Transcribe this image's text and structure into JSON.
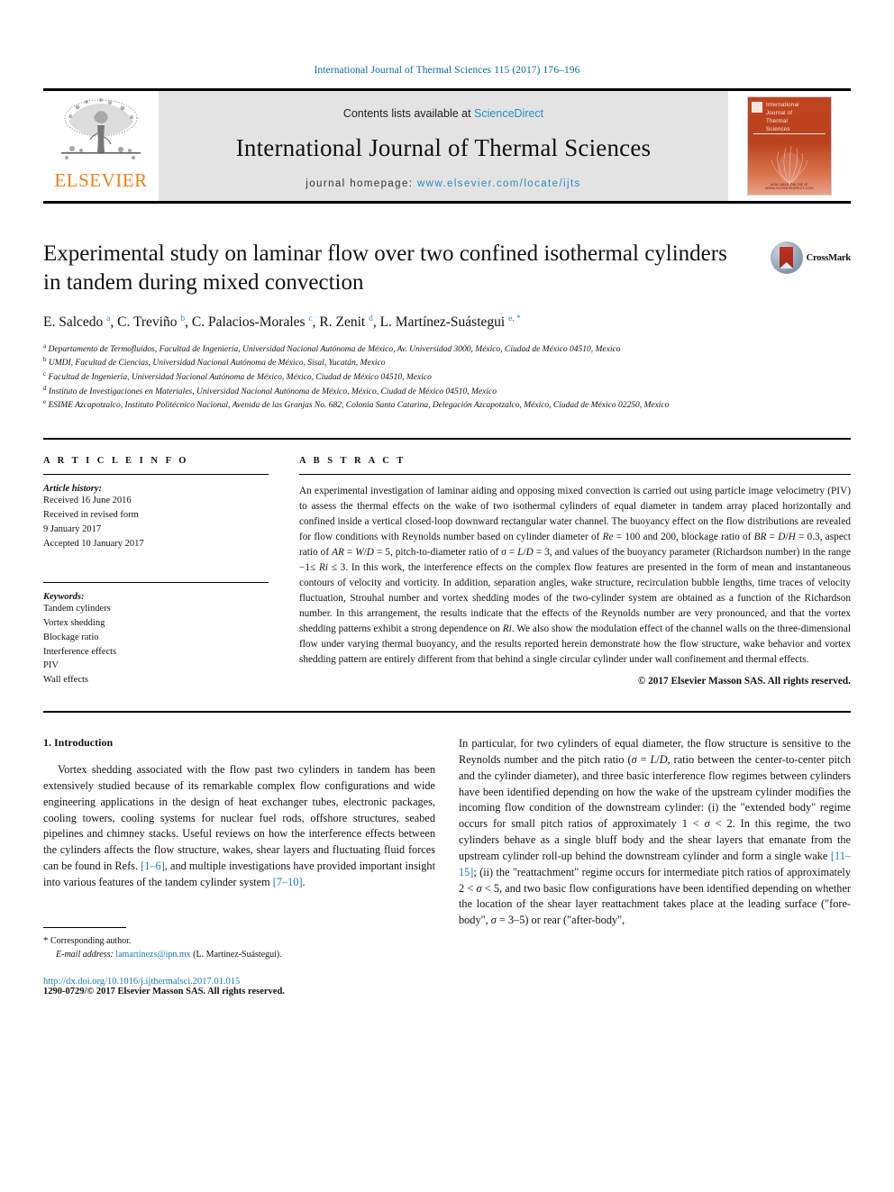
{
  "running_head": "International Journal of Thermal Sciences 115 (2017) 176–196",
  "masthead": {
    "contents_prefix": "Contents lists available at ",
    "sciencedirect": "ScienceDirect",
    "journal_title": "International Journal of Thermal Sciences",
    "homepage_prefix": "journal homepage: ",
    "homepage_url": "www.elsevier.com/locate/ijts",
    "publisher_logo_text": "ELSEVIER",
    "cover_title_lines": "International\nJournal of\nThermal\nSciences",
    "cover_footer": "AVAILABLE ONLINE AT WWW.SCIENCEDIRECT.COM",
    "accent_blue": "#2b8cc4",
    "elsevier_orange": "#f07f13",
    "cover_red": "#bb431e"
  },
  "article": {
    "title": "Experimental study on laminar flow over two confined isothermal cylinders in tandem during mixed convection",
    "authors_html": "E. Salcedo <sup>a</sup>, C. Treviño <sup>b</sup>, C. Palacios-Morales <sup>c</sup>, R. Zenit <sup>d</sup>, L. Martínez-Suástegui <sup>e, <span class=\"star\">*</span></sup>",
    "crossmark_label": "CrossMark",
    "affiliations": [
      "Departamento de Termofluidos, Facultad de Ingeniería, Universidad Nacional Autónoma de México, Av. Universidad 3000, México, Ciudad de México 04510, Mexico",
      "UMDI, Facultad de Ciencias, Universidad Nacional Autónoma de México, Sisal, Yucatán, Mexico",
      "Facultad de Ingeniería, Universidad Nacional Autónoma de México, México, Ciudad de México 04510, Mexico",
      "Instituto de Investigaciones en Materiales, Universidad Nacional Autónoma de México, México, Ciudad de México 04510, Mexico",
      "ESIME Azcapotzalco, Instituto Politécnico Nacional, Avenida de las Granjas No. 682, Colonia Santa Catarina, Delegación Azcapotzalco, México, Ciudad de México 02250, Mexico"
    ],
    "affiliation_markers": [
      "a",
      "b",
      "c",
      "d",
      "e"
    ]
  },
  "article_info": {
    "heading": "A R T I C L E   I N F O",
    "history_label": "Article history:",
    "history_lines": [
      "Received 16 June 2016",
      "Received in revised form",
      "9 January 2017",
      "Accepted 10 January 2017"
    ],
    "keywords_label": "Keywords:",
    "keywords": [
      "Tandem cylinders",
      "Vortex shedding",
      "Blockage ratio",
      "Interference effects",
      "PIV",
      "Wall effects"
    ]
  },
  "abstract": {
    "heading": "A B S T R A C T",
    "text_html": "An experimental investigation of laminar aiding and opposing mixed convection is carried out using particle image velocimetry (PIV) to assess the thermal effects on the wake of two isothermal cylinders of equal diameter in tandem array placed horizontally and confined inside a vertical closed-loop downward rectangular water channel. The buoyancy effect on the flow distributions are revealed for flow conditions with Reynolds number based on cylinder diameter of <i>Re</i> = 100 and 200, blockage ratio of <i>BR</i> = <i>D</i>/<i>H</i> = 0.3, aspect ratio of <i>AR</i> = <i>W</i>/<i>D</i> = 5, pitch-to-diameter ratio of <i>&sigma;</i> = <i>L</i>/<i>D</i> = 3, and values of the buoyancy parameter (Richardson number) in the range &minus;1&le; <i>Ri</i> &le; 3. In this work, the interference effects on the complex flow features are presented in the form of mean and instantaneous contours of velocity and vorticity. In addition, separation angles, wake structure, recirculation bubble lengths, time traces of velocity fluctuation, Strouhal number and vortex shedding modes of the two-cylinder system are obtained as a function of the Richardson number. In this arrangement, the results indicate that the effects of the Reynolds number are very pronounced, and that the vortex shedding patterns exhibit a strong dependence on <i>Ri</i>. We also show the modulation effect of the channel walls on the three-dimensional flow under varying thermal buoyancy, and the results reported herein demonstrate how the flow structure, wake behavior and vortex shedding pattern are entirely different from that behind a single circular cylinder under wall confinement and thermal effects.",
    "copyright": "© 2017 Elsevier Masson SAS. All rights reserved."
  },
  "body": {
    "section_heading": "1. Introduction",
    "left_paragraph_html": "Vortex shedding associated with the flow past two cylinders in tandem has been extensively studied because of its remarkable complex flow configurations and wide engineering applications in the design of heat exchanger tubes, electronic packages, cooling towers, cooling systems for nuclear fuel rods, offshore structures, seabed pipelines and chimney stacks. Useful reviews on how the interference effects between the cylinders affects the flow structure, wakes, shear layers and fluctuating fluid forces can be found in Refs. <span class=\"ref\">[1&ndash;6]</span>, and multiple investigations have provided important insight into various features of the tandem cylinder system <span class=\"ref\">[7&ndash;10]</span>.",
    "right_paragraph_html": "In particular, for two cylinders of equal diameter, the flow structure is sensitive to the Reynolds number and the pitch ratio (<i>&sigma;</i> = <i>L</i>/<i>D</i>, ratio between the center-to-center pitch and the cylinder diameter), and three basic interference flow regimes between cylinders have been identified depending on how the wake of the upstream cylinder modifies the incoming flow condition of the downstream cylinder: (i) the &quot;extended body&quot; regime occurs for small pitch ratios of approximately 1 &lt; <i>&sigma;</i> &lt; 2. In this regime, the two cylinders behave as a single bluff body and the shear layers that emanate from the upstream cylinder roll-up behind the downstream cylinder and form a single wake <span class=\"ref\">[11&ndash;15]</span>; (ii) the &quot;reattachment&quot; regime occurs for intermediate pitch ratios of approximately 2 &lt; <i>&sigma;</i> &lt; 5, and two basic flow configurations have been identified depending on whether the location of the shear layer reattachment takes place at the leading surface (&quot;fore-body&quot;, <i>&sigma;</i> = 3&ndash;5) or rear (&quot;after-body&quot;,"
  },
  "footnote": {
    "corresponding_star": "*",
    "corresponding_label": "Corresponding author.",
    "email_label": "E-mail address:",
    "email": "lamartinezs@ipn.mx",
    "email_owner": "(L. Martínez-Suástegui).",
    "doi": "http://dx.doi.org/10.1016/j.ijthermalsci.2017.01.015",
    "issn_line": "1290-0729/© 2017 Elsevier Masson SAS. All rights reserved."
  }
}
